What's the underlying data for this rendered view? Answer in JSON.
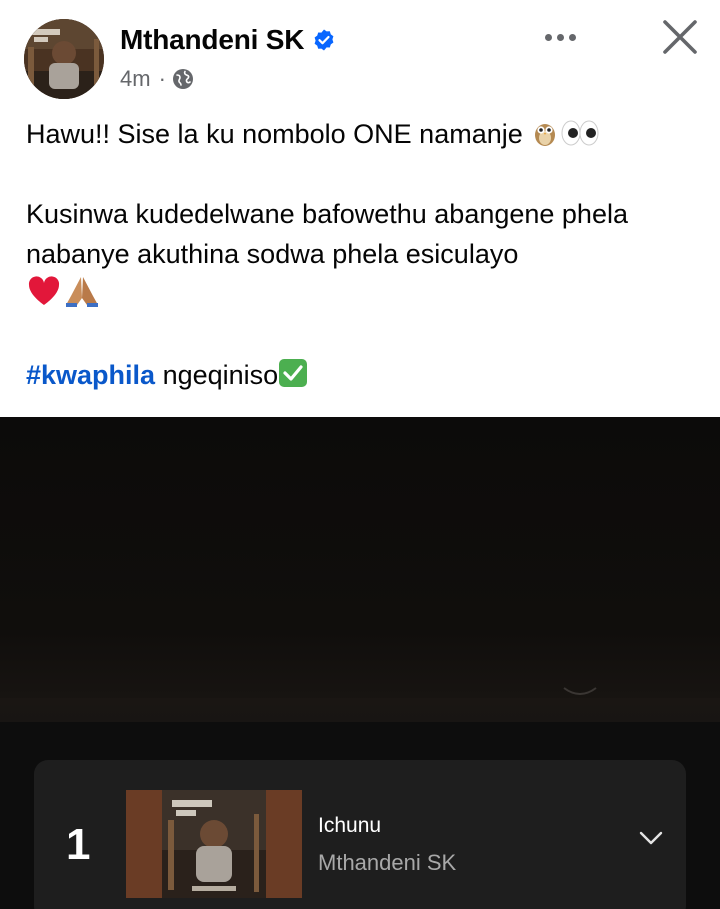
{
  "post": {
    "author_name": "Mthandeni SK",
    "verified": true,
    "timestamp": "4m",
    "meta_separator": "·",
    "audience_icon": "globe-icon",
    "more_icon": "more-dots-icon",
    "close_icon": "close-icon",
    "text": {
      "line1": "Hawu!! Sise la ku nombolo ONE namanje",
      "line1_emojis": [
        "owl",
        "eyes"
      ],
      "line2": "Kusinwa kudedelwane bafowethu abangene phela nabanye akuthina sodwa phela esiculayo",
      "line2_emojis": [
        "red-heart",
        "folded-hands"
      ],
      "hashtag": "#kwaphila",
      "line3_rest": " ngeqiniso",
      "line3_emoji": "check-mark-button"
    }
  },
  "chart_card": {
    "rank": "1",
    "track_title": "Ichunu",
    "track_artist": "Mthandeni SK",
    "expand_icon": "chevron-down-icon"
  },
  "colors": {
    "hashtag": "#0a58ca",
    "verified_badge": "#0866ff",
    "meta_text": "#65676b",
    "card_bg": "#1e1e1e"
  }
}
